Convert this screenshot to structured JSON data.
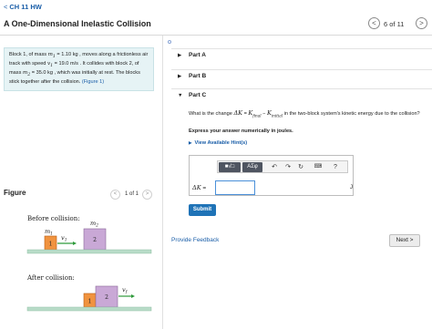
{
  "header": {
    "back_label": "CH 11 HW",
    "title": "A One-Dimensional Inelastic Collision",
    "counter": "6 of 11"
  },
  "problem": {
    "desc_1": "Block 1, of mass ",
    "m1": "m",
    "m1_sub": "1",
    "desc_2": " = 1.10 kg , moves along a frictionless air track with speed ",
    "v1": "v",
    "v1_sub": "1",
    "desc_3": " = 19.0 m/s . It collides with block 2, of mass ",
    "m2": "m",
    "m2_sub": "2",
    "desc_4": " = 35.0 kg , which was initially at rest. The blocks stick together after the collision. ",
    "figure_link": "(Figure 1)"
  },
  "parts": [
    {
      "marker": "▶",
      "label": "Part A"
    },
    {
      "marker": "▶",
      "label": "Part B"
    },
    {
      "marker": "▼",
      "label": "Part C"
    }
  ],
  "part_c": {
    "q_before": "What is the change ",
    "delta_k": "ΔK",
    "q_eq": " = ",
    "k_final": "K",
    "k_final_sub": "final",
    "q_minus": " − ",
    "k_initial": "K",
    "k_initial_sub": "initial",
    "q_after": " in the two-block system's kinetic energy due to the collision?",
    "instruction": "Express your answer numerically in joules.",
    "hints": "View Available Hint(s)",
    "answer_label": "ΔK",
    "answer_eq": " = ",
    "answer_value": "",
    "unit": "J",
    "submit": "Submit"
  },
  "toolbar": {
    "templates": "■√□",
    "greek": "AΣφ",
    "undo_icon": "undo-icon",
    "redo_icon": "redo-icon",
    "reset_icon": "reset-icon",
    "keyboard_icon": "keyboard-icon",
    "help": "?"
  },
  "footer": {
    "feedback": "Provide Feedback",
    "next": "Next >"
  },
  "figure": {
    "title": "Figure",
    "counter": "1 of 1",
    "before_label": "Before collision:",
    "after_label": "After collision:",
    "m1_label": "m",
    "m1_sub": "1",
    "m2_label": "m",
    "m2_sub": "2",
    "v1_label": "v",
    "v1_sub": "1",
    "vf_label": "v",
    "vf_sub": "f",
    "block1": "1",
    "block2": "2"
  },
  "colors": {
    "accent": "#1f73b7",
    "link": "#1a5ea8",
    "description_bg": "#e6f3f5",
    "block1": "#f0933f",
    "block2": "#c9a8d6",
    "track": "#b8dcc8",
    "arrow": "#2e9a3a"
  }
}
